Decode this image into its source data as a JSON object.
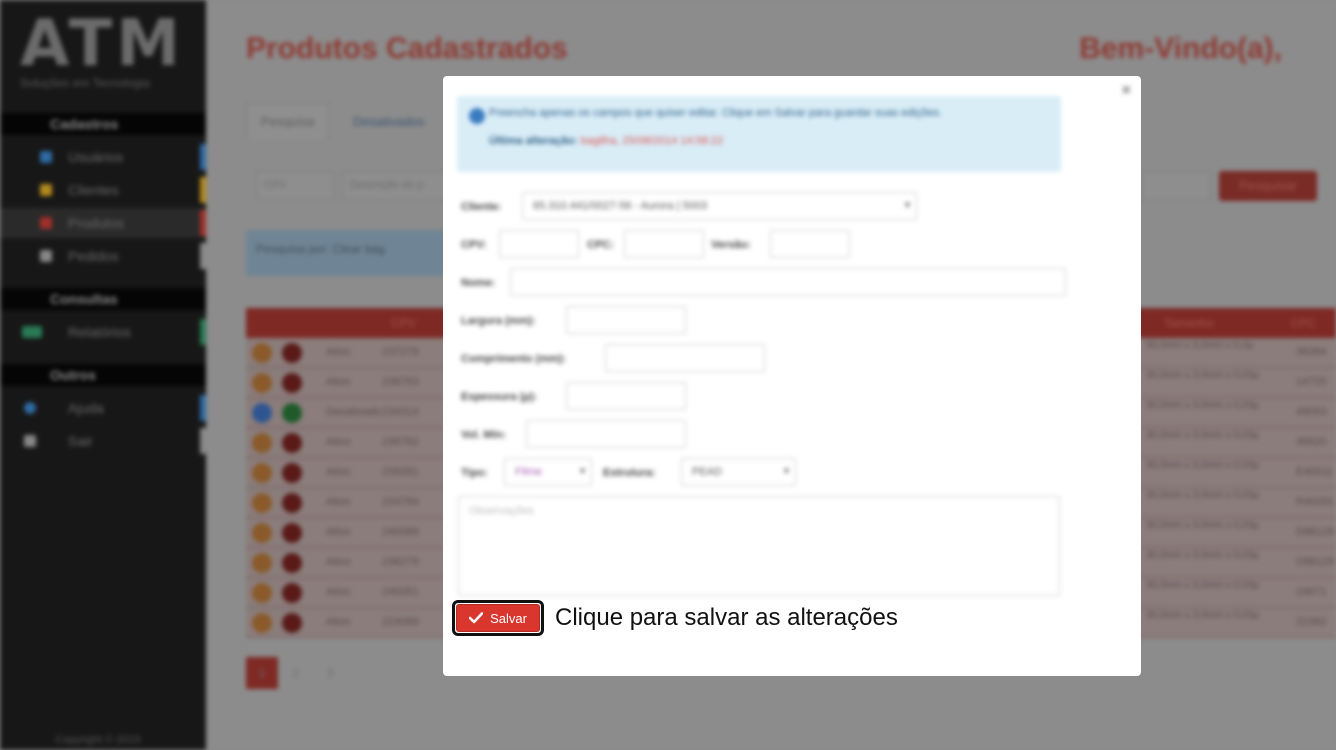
{
  "sidebar": {
    "logo": "ATM",
    "logo_sub": "Soluções em Tecnologia",
    "sections": [
      {
        "title": "Cadastros"
      },
      {
        "title": "Consultas"
      },
      {
        "title": "Outros"
      }
    ],
    "items": [
      {
        "label": "Usuários",
        "icon": "user-icon",
        "color": "#2f6aa3"
      },
      {
        "label": "Clientes",
        "icon": "clients-icon",
        "color": "#b48a1f"
      },
      {
        "label": "Produtos",
        "icon": "product-icon",
        "color": "#a0302a"
      },
      {
        "label": "Pedidos",
        "icon": "orders-icon",
        "color": "#888888"
      },
      {
        "label": "Relatórios",
        "icon": "chart-icon",
        "color": "#2a7a55"
      },
      {
        "label": "Ajuda",
        "icon": "help-icon",
        "color": "#2f6aa3"
      },
      {
        "label": "Sair",
        "icon": "exit-icon",
        "color": "#888888"
      }
    ],
    "copyright": "Copyright © 2015"
  },
  "header": {
    "title": "Produtos Cadastrados",
    "welcome": "Bem-Vindo(a),"
  },
  "tabs": [
    {
      "label": "Pesquisa"
    },
    {
      "label": "Desativados"
    }
  ],
  "search": {
    "cpv_placeholder": "CPV",
    "desc_placeholder": "Descrição do p",
    "button": "Pesquisar"
  },
  "info_bar": {
    "text": "Pesquisa por: Clear bag"
  },
  "table": {
    "header_cpv": "CPV",
    "header_size": "Tamanho",
    "header_cpc": "CPC",
    "rows": [
      {
        "type": "Ativo",
        "cpv": "237279",
        "size": "30,0mm x 3,0mm x 0,4µ",
        "cpc": "36394"
      },
      {
        "type": "Ativo",
        "cpv": "236763",
        "size": "30,0mm x 3,0mm x 0,03µ",
        "cpc": "14725"
      },
      {
        "type": "Desativado",
        "cpv": "234314",
        "size": "30,0mm x 3,0mm x 0,03µ",
        "cpc": "49053"
      },
      {
        "type": "Ativo",
        "cpv": "236762",
        "size": "30,0mm x 3,0mm x 0,03µ",
        "cpc": "36620"
      },
      {
        "type": "Ativo",
        "cpv": "239281",
        "size": "30,0mm x 3,0mm x 0,03µ",
        "cpc": "E40011"
      },
      {
        "type": "Ativo",
        "cpv": "234784",
        "size": "30,0mm x 3,0mm x 0,03µ",
        "cpc": "R40281"
      },
      {
        "type": "Ativo",
        "cpv": "240089",
        "size": "30,0mm x 3,0mm x 0,03µ",
        "cpc": "D88129"
      },
      {
        "type": "Ativo",
        "cpv": "236279",
        "size": "30,0mm x 3,0mm x 0,03µ",
        "cpc": "D88129"
      },
      {
        "type": "Ativo",
        "cpv": "240051",
        "size": "30,0mm x 3,0mm x 0,03µ",
        "cpc": "24671"
      },
      {
        "type": "Ativo",
        "cpv": "224069",
        "size": "30,0mm x 3,0mm x 0,03µ",
        "cpc": "22392"
      }
    ]
  },
  "pagination": [
    "1",
    "2",
    "3"
  ],
  "modal": {
    "close": "×",
    "alert_text": "Preencha apenas os campos que quiser editar. Clique em Salvar para guardar suas edições.",
    "last_change_label": "Última alteração:",
    "last_change_value": "bagilha, 25/08/2014 14:58:22",
    "fields": {
      "cliente_label": "Cliente:",
      "cliente_value": "65.310.441/0027-56 - Aurora | 5003",
      "cpv_label": "CPV:",
      "cpc_label": "CPC:",
      "versao_label": "Versão:",
      "nome_label": "Nome:",
      "largura_label": "Largura (mm):",
      "comprimento_label": "Comprimento (mm):",
      "espessura_label": "Espessura (µ):",
      "volmin_label": "Vol. Mín:",
      "tipo_label": "Tipo:",
      "tipo_value": "Filme",
      "estrutura_label": "Estrutura:",
      "estrutura_value": "PEAD",
      "obs_placeholder": "Observações"
    },
    "save_label": "Salvar",
    "callout": "Clique para salvar as alterações",
    "save_color": "#d9372e"
  }
}
